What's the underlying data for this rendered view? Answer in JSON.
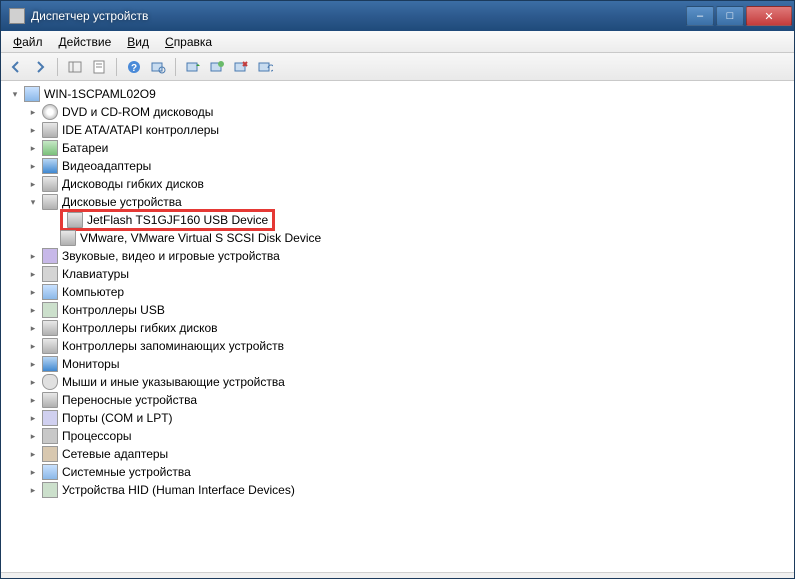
{
  "window": {
    "title": "Диспетчер устройств",
    "controls": {
      "min": "–",
      "max": "□",
      "close": "✕"
    }
  },
  "menu": {
    "file": "Файл",
    "action": "Действие",
    "view": "Вид",
    "help": "Справка"
  },
  "toolbar_icons": [
    "back-icon",
    "forward-icon",
    "sep",
    "show-hide-tree-icon",
    "properties-icon",
    "sep",
    "help-icon",
    "scan-hardware-icon",
    "sep",
    "update-driver-icon",
    "uninstall-icon",
    "disable-icon",
    "enable-icon"
  ],
  "tree": {
    "root": "WIN-1SCPAML02O9",
    "nodes": [
      {
        "label": "DVD и CD-ROM дисководы",
        "icon": "cd",
        "expanded": false
      },
      {
        "label": "IDE ATA/ATAPI контроллеры",
        "icon": "disk",
        "expanded": false
      },
      {
        "label": "Батареи",
        "icon": "battery",
        "expanded": false
      },
      {
        "label": "Видеоадаптеры",
        "icon": "monitor",
        "expanded": false
      },
      {
        "label": "Дисководы гибких дисков",
        "icon": "disk",
        "expanded": false
      },
      {
        "label": "Дисковые устройства",
        "icon": "disk",
        "expanded": true,
        "children": [
          {
            "label": "JetFlash TS1GJF160 USB Device",
            "icon": "disk",
            "highlighted": true
          },
          {
            "label": "VMware, VMware Virtual S SCSI Disk Device",
            "icon": "disk"
          }
        ]
      },
      {
        "label": "Звуковые, видео и игровые устройства",
        "icon": "sound",
        "expanded": false
      },
      {
        "label": "Клавиатуры",
        "icon": "keyboard",
        "expanded": false
      },
      {
        "label": "Компьютер",
        "icon": "computer",
        "expanded": false
      },
      {
        "label": "Контроллеры USB",
        "icon": "usb",
        "expanded": false
      },
      {
        "label": "Контроллеры гибких дисков",
        "icon": "disk",
        "expanded": false
      },
      {
        "label": "Контроллеры запоминающих устройств",
        "icon": "disk",
        "expanded": false
      },
      {
        "label": "Мониторы",
        "icon": "monitor",
        "expanded": false
      },
      {
        "label": "Мыши и иные указывающие устройства",
        "icon": "mouse",
        "expanded": false
      },
      {
        "label": "Переносные устройства",
        "icon": "disk",
        "expanded": false
      },
      {
        "label": "Порты (COM и LPT)",
        "icon": "port",
        "expanded": false
      },
      {
        "label": "Процессоры",
        "icon": "cpu",
        "expanded": false
      },
      {
        "label": "Сетевые адаптеры",
        "icon": "net",
        "expanded": false
      },
      {
        "label": "Системные устройства",
        "icon": "computer",
        "expanded": false
      },
      {
        "label": "Устройства HID (Human Interface Devices)",
        "icon": "usb",
        "expanded": false
      }
    ]
  }
}
